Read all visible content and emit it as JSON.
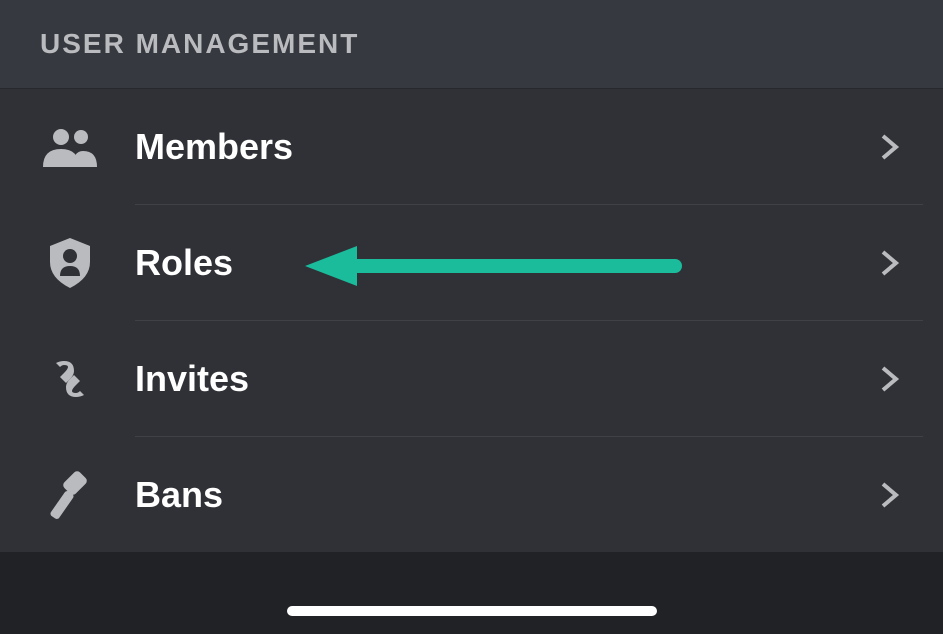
{
  "header": {
    "title": "USER MANAGEMENT"
  },
  "items": [
    {
      "label": "Members"
    },
    {
      "label": "Roles"
    },
    {
      "label": "Invites"
    },
    {
      "label": "Bans"
    }
  ],
  "annotation": {
    "color": "#1abc9c"
  }
}
